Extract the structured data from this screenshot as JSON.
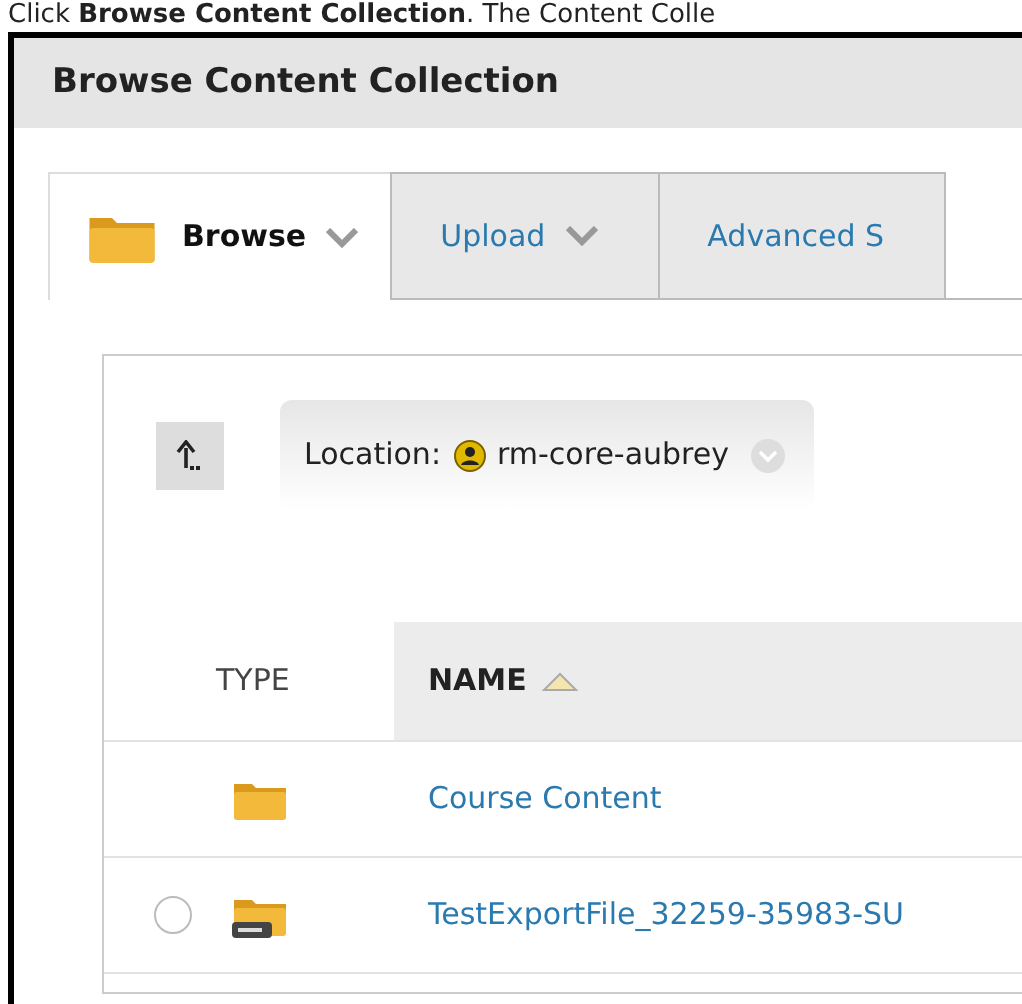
{
  "caption": "Click **Browse Content Collection**. The Content Colle",
  "page_title": "Browse Content Collection",
  "tabs": [
    {
      "label": "Browse",
      "selected": true,
      "has_menu": true
    },
    {
      "label": "Upload",
      "selected": false,
      "has_menu": true
    },
    {
      "label": "Advanced S",
      "selected": false,
      "has_menu": false
    }
  ],
  "location": {
    "label": "Location:",
    "value": "rm-core-aubrey"
  },
  "table": {
    "columns": [
      {
        "label": "TYPE",
        "sorted": false
      },
      {
        "label": "NAME",
        "sorted": true
      }
    ],
    "rows": [
      {
        "kind": "folder",
        "name": "Course Content"
      },
      {
        "kind": "zip",
        "name": "TestExportFile_32259-35983-SU",
        "selected": false
      }
    ]
  }
}
